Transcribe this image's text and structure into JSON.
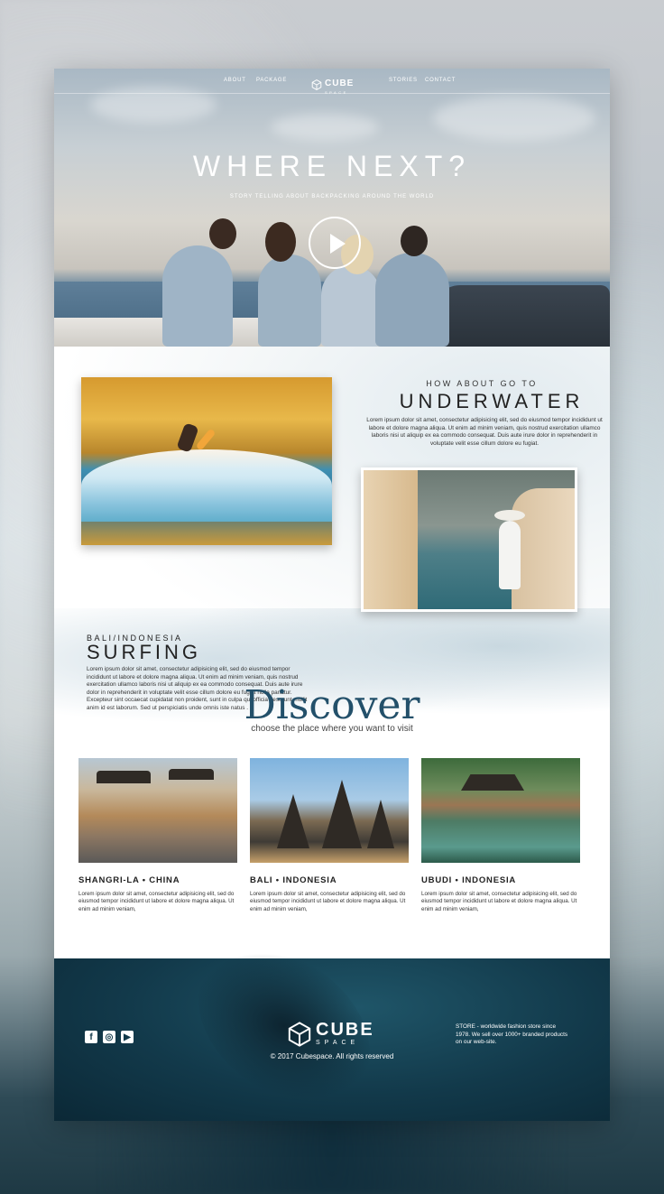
{
  "nav": {
    "about": "ABOUT",
    "package": "PACKAGE",
    "stories": "STORIES",
    "contact": "CONTACT",
    "logo_word": "CUBE",
    "logo_sub": "SPACE"
  },
  "hero": {
    "title": "WHERE NEXT?",
    "subtitle": "STORY TELLING ABOUT BACKPACKING AROUND THE WORLD"
  },
  "underwater": {
    "pre": "HOW ABOUT GO TO",
    "title": "UNDERWATER",
    "body": "Lorem ipsum dolor sit amet, consectetur adipisicing elit, sed do eiusmod tempor incididunt ut labore et dolore magna aliqua. Ut enim ad minim veniam, quis nostrud exercitation ullamco laboris nisi ut aliquip ex ea commodo consequat. Duis aute irure dolor in reprehenderit in voluptate velit esse cillum dolore eu fugiat."
  },
  "surfing": {
    "pre": "BALI/INDONESIA",
    "title": "SURFING",
    "body": "Lorem ipsum dolor sit amet, consectetur adipisicing elit, sed do eiusmod tempor incididunt ut labore et dolore magna aliqua. Ut enim ad minim veniam, quis nostrud exercitation ullamco laboris nisi ut aliquip ex ea commodo consequat. Duis aute irure dolor in reprehenderit in voluptate velit esse cillum dolore eu fugiat nulla pariatur. Excepteur sint occaecat cupidatat non proident, sunt in culpa qui officia deserunt mollit anim id est laborum. Sed ut perspiciatis unde omnis iste natus ."
  },
  "discover": {
    "title": "Discover",
    "subtitle": "choose the place where you want to visit",
    "cards": [
      {
        "caption": "SHANGRI-LA • CHINA",
        "text": "Lorem ipsum dolor sit amet, consectetur adipisicing elit, sed do eiusmod tempor incididunt ut labore et dolore magna aliqua. Ut enim ad minim veniam,"
      },
      {
        "caption": "BALI • INDONESIA",
        "text": "Lorem ipsum dolor sit amet, consectetur adipisicing elit, sed do eiusmod tempor incididunt ut labore et dolore magna aliqua. Ut enim ad minim veniam,"
      },
      {
        "caption": "UBUDI • INDONESIA",
        "text": "Lorem ipsum dolor sit amet, consectetur adipisicing elit, sed do eiusmod tempor incididunt ut labore et dolore magna aliqua. Ut enim ad minim veniam,"
      }
    ]
  },
  "footer": {
    "logo_word": "CUBE",
    "logo_sub": "SPACE",
    "copyright": "© 2017 Cubespace. All rights reserved",
    "store_text": "STORE - worldwide fashion store since 1978. We sell over 1000+ branded products on our web-site.",
    "social": [
      {
        "icon": "facebook-icon",
        "glyph": "f"
      },
      {
        "icon": "instagram-icon",
        "glyph": "◎"
      },
      {
        "icon": "youtube-icon",
        "glyph": "▶"
      }
    ]
  },
  "colors": {
    "discover_title": "#23506a",
    "footer_bg": "#12394a"
  }
}
